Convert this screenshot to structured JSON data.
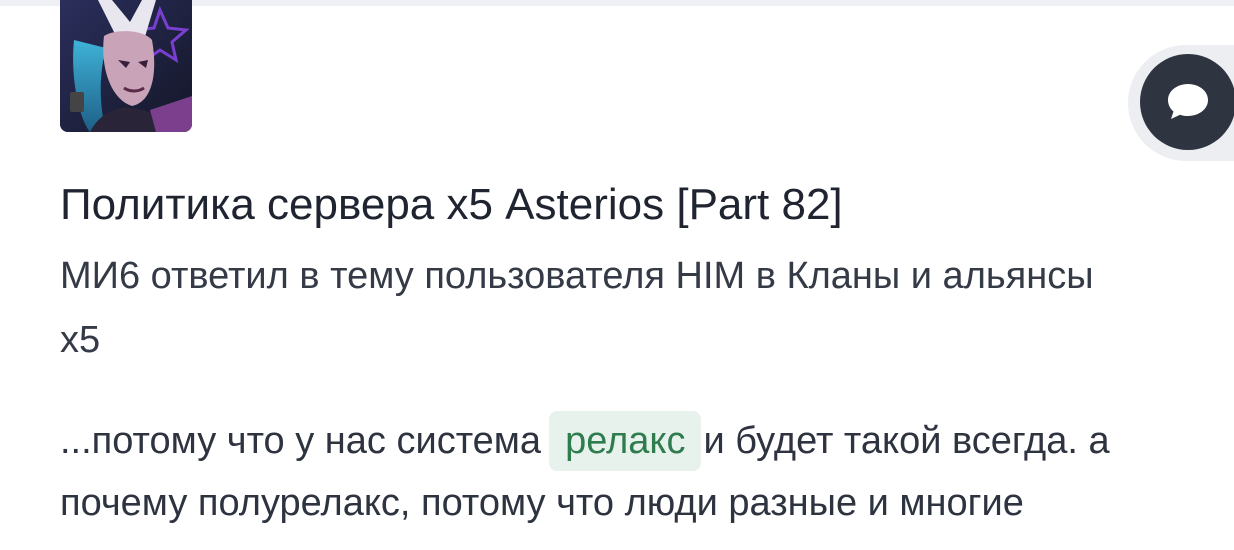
{
  "feed_item": {
    "title": "Политика сервера х5 Asterios [Part 82]",
    "meta": "МИ6 ответил в тему пользователя HIM в Кланы и альянсы x5",
    "snippet": {
      "before": "...потому что у нас система",
      "highlight": "релакс",
      "after": "и будет такой всегда. а почему полурелакс, потому что люди разные и многие"
    }
  },
  "chat_fab": {
    "icon": "chat-bubble-icon"
  },
  "colors": {
    "fab_background": "#2f3441",
    "highlight_background": "#e8f2ec",
    "highlight_text": "#2f7d4f",
    "title_text": "#1f2430"
  }
}
